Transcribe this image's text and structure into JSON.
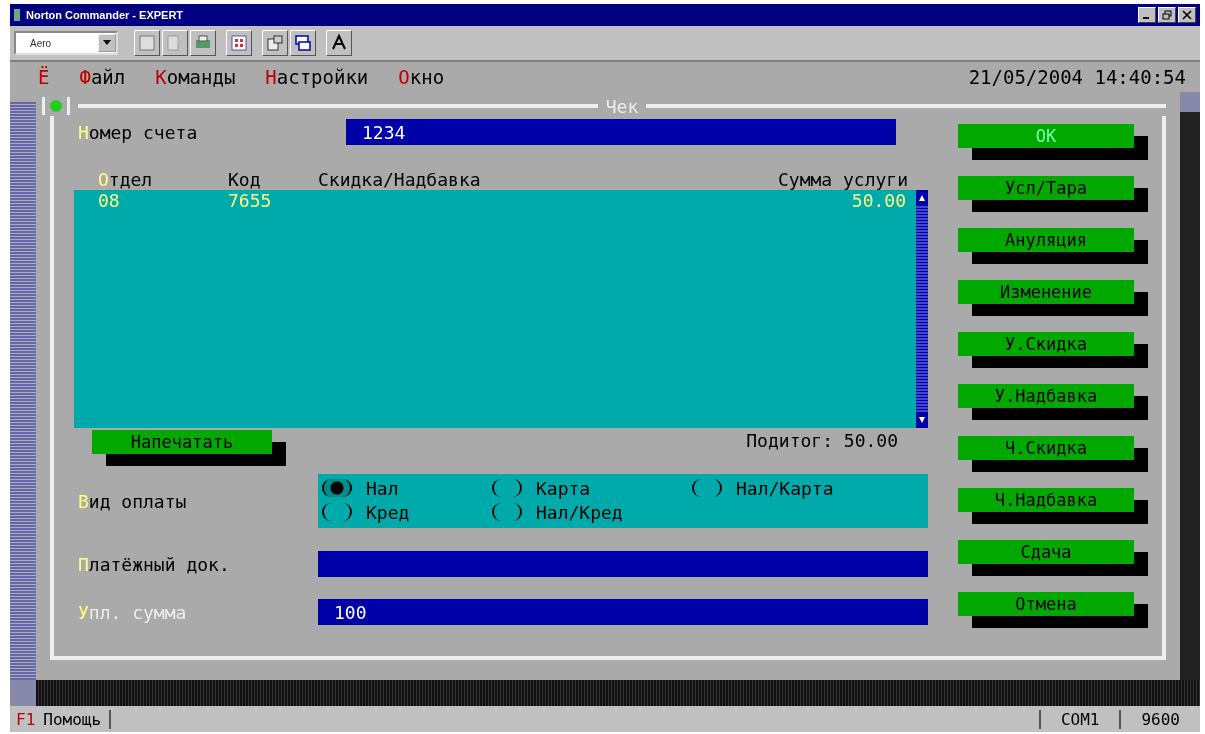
{
  "window": {
    "title": "Norton Commander - EXPERT"
  },
  "toolbar": {
    "font_select": {
      "value": "Aero"
    }
  },
  "menu": [
    {
      "label": "Ё",
      "kind": "system"
    },
    {
      "label": "Файл",
      "kind": "item"
    },
    {
      "label": "Команды",
      "kind": "item"
    },
    {
      "label": "Настройки",
      "kind": "item"
    },
    {
      "label": "Окно",
      "kind": "item"
    }
  ],
  "clock": "21/05/2004 14:40:54",
  "dialog": {
    "title": "Чек",
    "account": {
      "label": "Номер счета",
      "value": "1234"
    },
    "table": {
      "columns": [
        "Отдел",
        "Код",
        "Скидка/Надбавка",
        "Сумма услуги"
      ],
      "rows": [
        {
          "cells": [
            "08",
            "7655",
            "",
            "50.00"
          ]
        }
      ]
    },
    "print_button": "Напечатать",
    "subtotal": "Подитог: 50.00",
    "payment": {
      "label": "Вид оплаты",
      "options": [
        {
          "label": "Нал",
          "selected": true
        },
        {
          "label": "Карта",
          "selected": false
        },
        {
          "label": "Нал/Карта",
          "selected": false
        },
        {
          "label": "Кред",
          "selected": false
        },
        {
          "label": "Нал/Кред",
          "selected": false
        }
      ]
    },
    "document": {
      "label": "Платёжный док."
    },
    "paid": {
      "label": "Упл. сумма",
      "value": "100"
    },
    "buttons": [
      {
        "label": "OK",
        "focused": true
      },
      {
        "label": "Усл/Тара",
        "focused": false
      },
      {
        "label": "Ануляция",
        "focused": false
      },
      {
        "label": "Изменение",
        "focused": false
      },
      {
        "label": "У.Скидка",
        "focused": false
      },
      {
        "label": "У.Надбавка",
        "focused": false
      },
      {
        "label": "Ч.Скидка",
        "focused": false
      },
      {
        "label": "Ч.Надбавка",
        "focused": false
      },
      {
        "label": "Сдача",
        "focused": false
      },
      {
        "label": "Отмена",
        "focused": false
      }
    ]
  },
  "status_bar": {
    "key": "F1",
    "action": "Помощь",
    "port": "COM1",
    "speed": "9600"
  }
}
